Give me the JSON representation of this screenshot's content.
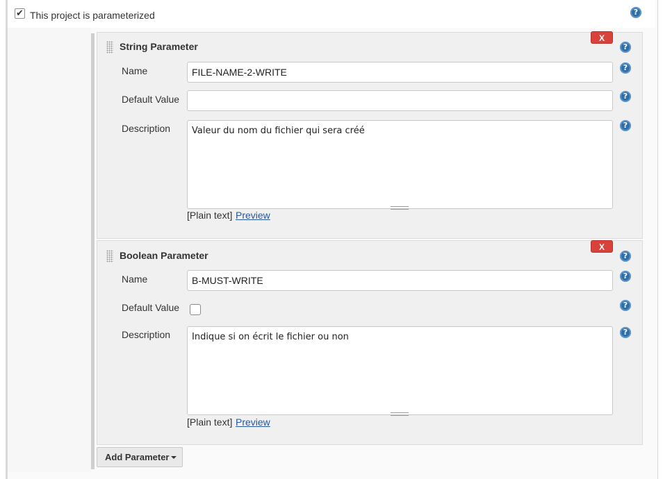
{
  "header": {
    "parameterized_label": "This project is parameterized",
    "parameterized_checked": true
  },
  "string_param": {
    "title": "String Parameter",
    "remove_label": "X",
    "name_label": "Name",
    "name_value": "FILE-NAME-2-WRITE",
    "default_label": "Default Value",
    "default_value": "",
    "desc_label": "Description",
    "desc_value": "Valeur du nom du fichier qui sera créé",
    "plain_text": "[Plain text]",
    "preview": "Preview"
  },
  "boolean_param": {
    "title": "Boolean Parameter",
    "remove_label": "X",
    "name_label": "Name",
    "name_value": "B-MUST-WRITE",
    "default_label": "Default Value",
    "default_checked": false,
    "desc_label": "Description",
    "desc_value": "Indique si on écrit le fichier ou non",
    "plain_text": "[Plain text]",
    "preview": "Preview"
  },
  "add_parameter_label": "Add Parameter",
  "help_glyph": "?",
  "colors": {
    "remove": "#d9423a",
    "help": "#2f6fa8",
    "link": "#28579c"
  }
}
